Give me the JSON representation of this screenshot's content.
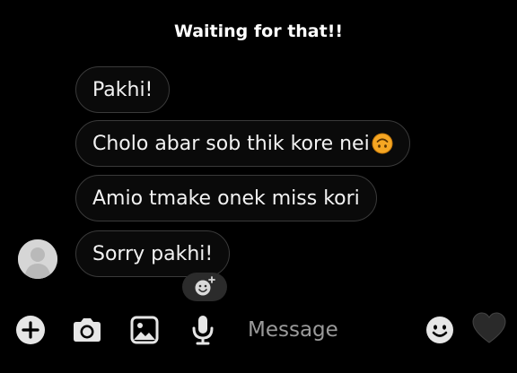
{
  "caption": "Waiting for that!!",
  "messages": [
    {
      "text": "Pakhi!"
    },
    {
      "text": "Cholo abar sob thik kore nei",
      "emoji": "upside-down-face"
    },
    {
      "text": "Amio tmake onek miss kori"
    },
    {
      "text": "Sorry pakhi!"
    }
  ],
  "composer": {
    "placeholder": "Message",
    "icons": [
      "add-icon",
      "camera-icon",
      "gallery-icon",
      "microphone-icon",
      "emoji-icon",
      "heart-icon"
    ]
  },
  "colors": {
    "background": "#000000",
    "bubble_border": "#3a3a3a",
    "emoji_yellow": "#f5a623",
    "heart": "#2a2a2a"
  }
}
